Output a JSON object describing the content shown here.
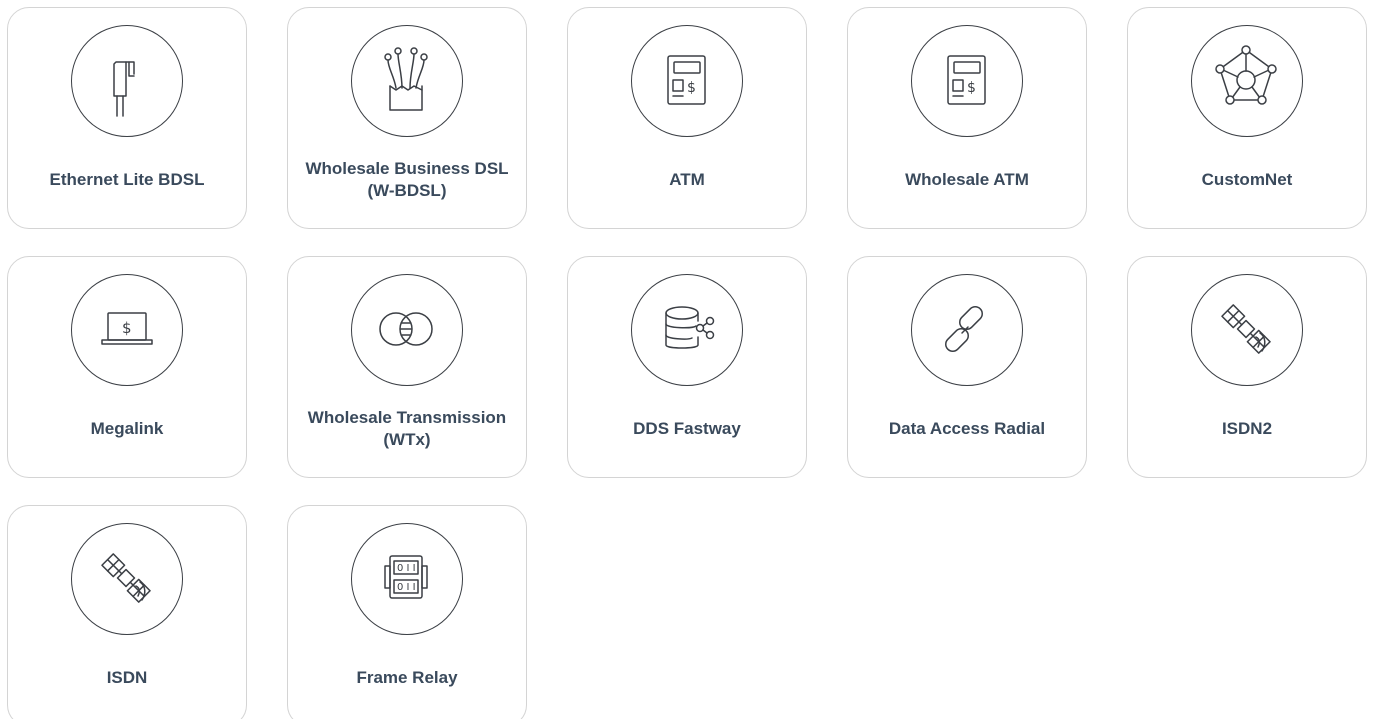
{
  "cards": [
    {
      "label": "Ethernet Lite BDSL",
      "icon": "ethernet-cable-icon"
    },
    {
      "label": "Wholesale Business DSL (W-BDSL)",
      "icon": "fiber-optic-icon"
    },
    {
      "label": "ATM",
      "icon": "atm-machine-icon"
    },
    {
      "label": "Wholesale ATM",
      "icon": "atm-machine-icon"
    },
    {
      "label": "CustomNet",
      "icon": "network-nodes-icon"
    },
    {
      "label": "Megalink",
      "icon": "laptop-dollar-icon"
    },
    {
      "label": "Wholesale Transmission (WTx)",
      "icon": "overlapping-circles-icon"
    },
    {
      "label": "DDS Fastway",
      "icon": "database-share-icon"
    },
    {
      "label": "Data Access Radial",
      "icon": "chain-link-icon"
    },
    {
      "label": "ISDN2",
      "icon": "satellite-icon"
    },
    {
      "label": "ISDN",
      "icon": "satellite-icon"
    },
    {
      "label": "Frame Relay",
      "icon": "frame-relay-device-icon"
    }
  ],
  "colors": {
    "card_border": "#d4d4d4",
    "icon_stroke": "#3b3f45",
    "label_text": "#3a4a5c"
  }
}
